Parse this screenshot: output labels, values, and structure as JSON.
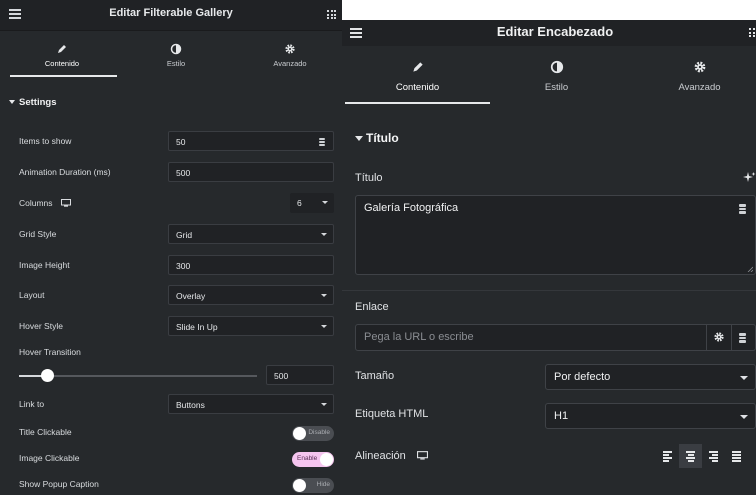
{
  "left_panel": {
    "title": "Editar Filterable Gallery",
    "tabs": [
      {
        "label": "Contenido",
        "icon": "pencil-icon",
        "active": true
      },
      {
        "label": "Estilo",
        "icon": "contrast-icon",
        "active": false
      },
      {
        "label": "Avanzado",
        "icon": "gear-icon",
        "active": false
      }
    ],
    "section_title": "Settings",
    "items_to_show": {
      "label": "Items to show",
      "value": "50"
    },
    "animation_duration": {
      "label": "Animation Duration (ms)",
      "value": "500"
    },
    "columns": {
      "label": "Columns",
      "value": "6"
    },
    "grid_style": {
      "label": "Grid Style",
      "value": "Grid"
    },
    "image_height": {
      "label": "Image Height",
      "value": "300"
    },
    "layout": {
      "label": "Layout",
      "value": "Overlay"
    },
    "hover_style": {
      "label": "Hover Style",
      "value": "Slide In Up"
    },
    "hover_transition": {
      "label": "Hover Transition",
      "value": "500",
      "slider_fraction": 0.12
    },
    "link_to": {
      "label": "Link to",
      "value": "Buttons"
    },
    "title_clickable": {
      "label": "Title Clickable",
      "state": "Disable"
    },
    "image_clickable": {
      "label": "Image Clickable",
      "state": "Enable"
    },
    "show_popup_caption": {
      "label": "Show Popup Caption",
      "state": "Hide"
    }
  },
  "right_panel": {
    "title": "Editar Encabezado",
    "tabs": [
      {
        "label": "Contenido",
        "icon": "pencil-icon",
        "active": true
      },
      {
        "label": "Estilo",
        "icon": "contrast-icon",
        "active": false
      },
      {
        "label": "Avanzado",
        "icon": "gear-icon",
        "active": false
      }
    ],
    "section_title": "Título",
    "titulo": {
      "label": "Título",
      "value": "Galería Fotográfica"
    },
    "enlace": {
      "label": "Enlace",
      "placeholder": "Pega la URL o escribe"
    },
    "tamano": {
      "label": "Tamaño",
      "value": "Por defecto"
    },
    "etiqueta_html": {
      "label": "Etiqueta HTML",
      "value": "H1"
    },
    "alineacion": {
      "label": "Alineación",
      "options": [
        "left",
        "center",
        "right",
        "justify"
      ],
      "selected": "center"
    }
  },
  "colors": {
    "panel_bg": "#26292c",
    "header_bg": "#202225",
    "toggle_on": "#f5c5ef"
  }
}
